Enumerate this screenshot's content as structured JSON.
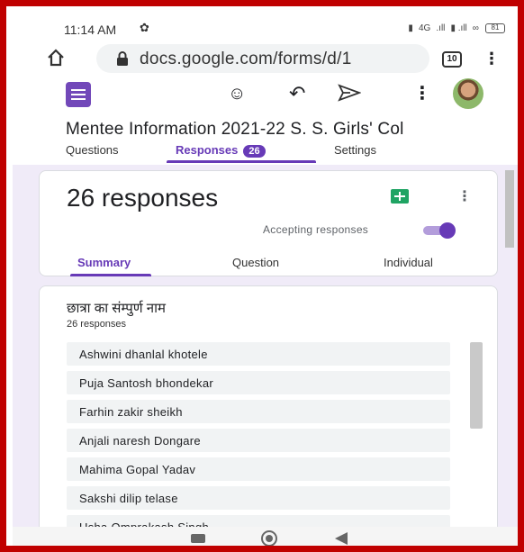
{
  "status_bar": {
    "time": "11:14 AM",
    "network_label": "4G",
    "battery": "81"
  },
  "browser": {
    "url": "docs.google.com/forms/d/1",
    "tab_count": "10"
  },
  "form": {
    "title": "Mentee Information 2021-22 S. S. Girls' Col",
    "tabs": {
      "questions": "Questions",
      "responses": "Responses",
      "responses_badge": "26",
      "settings": "Settings"
    },
    "responses_card": {
      "count_label": "26 responses",
      "accepting_label": "Accepting responses",
      "accepting_enabled": true,
      "subtabs": [
        "Summary",
        "Question",
        "Individual"
      ]
    },
    "question": {
      "title": "छात्रा का संम्पुर्ण नाम",
      "count_label": "26 responses",
      "answers": [
        "Ashwini dhanlal khotele",
        "Puja Santosh bhondekar",
        "Farhin zakir sheikh",
        "Anjali naresh Dongare",
        "Mahima Gopal Yadav",
        "Sakshi dilip telase",
        "Usha Omprakash Singh"
      ]
    }
  },
  "colors": {
    "accent": "#673ab7",
    "frame": "#c00000",
    "page_bg": "#f0ebf8",
    "sheets": "#1fa463"
  }
}
